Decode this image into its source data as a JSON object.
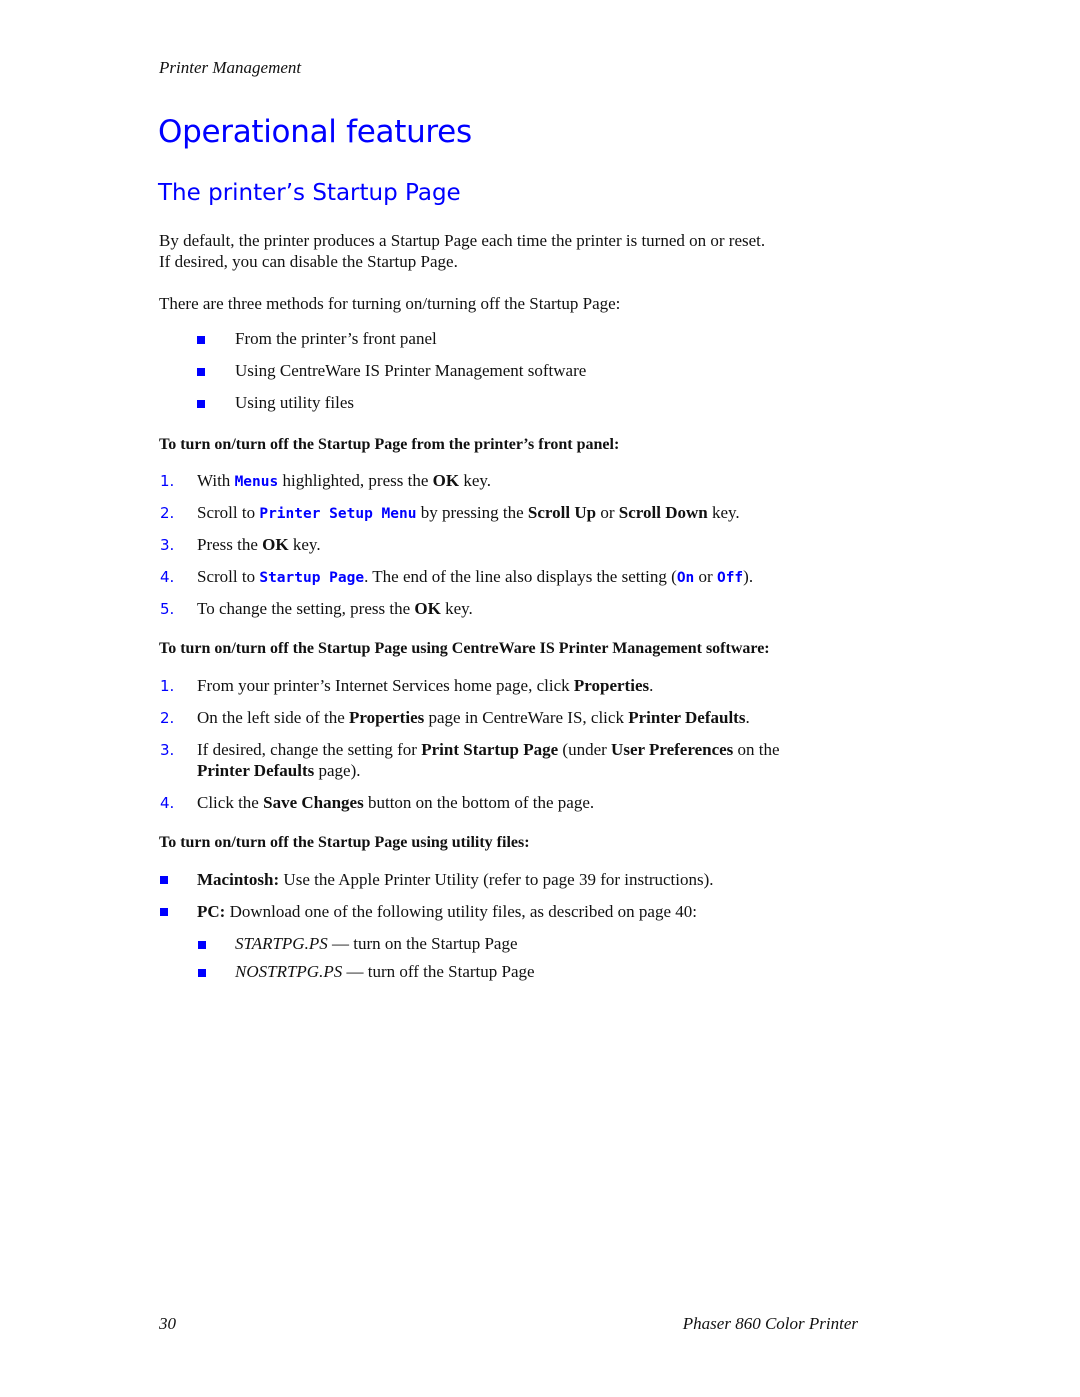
{
  "header": {
    "running_head": "Printer Management"
  },
  "title": "Operational features",
  "subtitle": "The printer’s Startup Page",
  "intro": {
    "line1": "By default, the printer produces a Startup Page each time the printer is turned on or reset.",
    "line2": "If desired, you can disable the Startup Page.",
    "methods_lead": "There are three methods for turning on/turning off the Startup Page:",
    "methods": [
      "From the printer’s front panel",
      "Using CentreWare IS Printer Management software",
      "Using utility files"
    ]
  },
  "front_panel": {
    "heading": "To turn on/turn off the Startup Page from the printer’s front panel:",
    "steps": [
      {
        "num": "1.",
        "pre": "With ",
        "code": "Menus",
        "mid": " highlighted, press the ",
        "bold": "OK",
        "post": " key."
      },
      {
        "num": "2.",
        "pre": "Scroll to ",
        "code": "Printer Setup Menu",
        "mid": " by pressing the ",
        "bold1": "Scroll Up",
        "or": " or ",
        "bold2": "Scroll Down",
        "post": " key."
      },
      {
        "num": "3.",
        "pre": "Press the ",
        "bold": "OK",
        "post": " key."
      },
      {
        "num": "4.",
        "pre": "Scroll to ",
        "code": "Startup Page",
        "mid": ". The end of the line also displays the setting (",
        "code_on": "On",
        "or": " or ",
        "code_off": "Off",
        "post": ")."
      },
      {
        "num": "5.",
        "pre": "To change the setting, press the ",
        "bold": "OK",
        "post": " key."
      }
    ]
  },
  "centreware": {
    "heading": "To turn on/turn off the Startup Page using CentreWare IS Printer Management software:",
    "steps": [
      {
        "num": "1.",
        "pre": "From your printer’s Internet Services home page, click ",
        "bold": "Properties",
        "post": "."
      },
      {
        "num": "2.",
        "pre": "On the left side of the ",
        "bold1": "Properties",
        "mid": " page in CentreWare IS, click ",
        "bold2": "Printer Defaults",
        "post": "."
      },
      {
        "num": "3.",
        "pre": "If desired, change the setting for ",
        "bold1": "Print Startup Page",
        "mid": " (under ",
        "bold2": "User Preferences",
        "mid2": " on the ",
        "bold3": "Printer Defaults",
        "post": " page)."
      },
      {
        "num": "4.",
        "pre": "Click the ",
        "bold": "Save Changes",
        "post": " button on the bottom of the page."
      }
    ]
  },
  "utility": {
    "heading": "To turn on/turn off the Startup Page using utility files:",
    "items": [
      {
        "bold": "Macintosh:",
        "text": " Use the Apple Printer Utility (refer to page 39 for instructions)."
      },
      {
        "bold": "PC:",
        "text": " Download one of the following utility files, as described on page 40:"
      }
    ],
    "subitems": [
      {
        "file": "STARTPG.PS",
        "text": " — turn on the Startup Page"
      },
      {
        "file": "NOSTRTPG.PS",
        "text": " — turn off the Startup Page"
      }
    ]
  },
  "footer": {
    "page_number": "30",
    "product": "Phaser 860 Color Printer"
  },
  "colors": {
    "accent": "#0000ff",
    "text": "#111111"
  }
}
